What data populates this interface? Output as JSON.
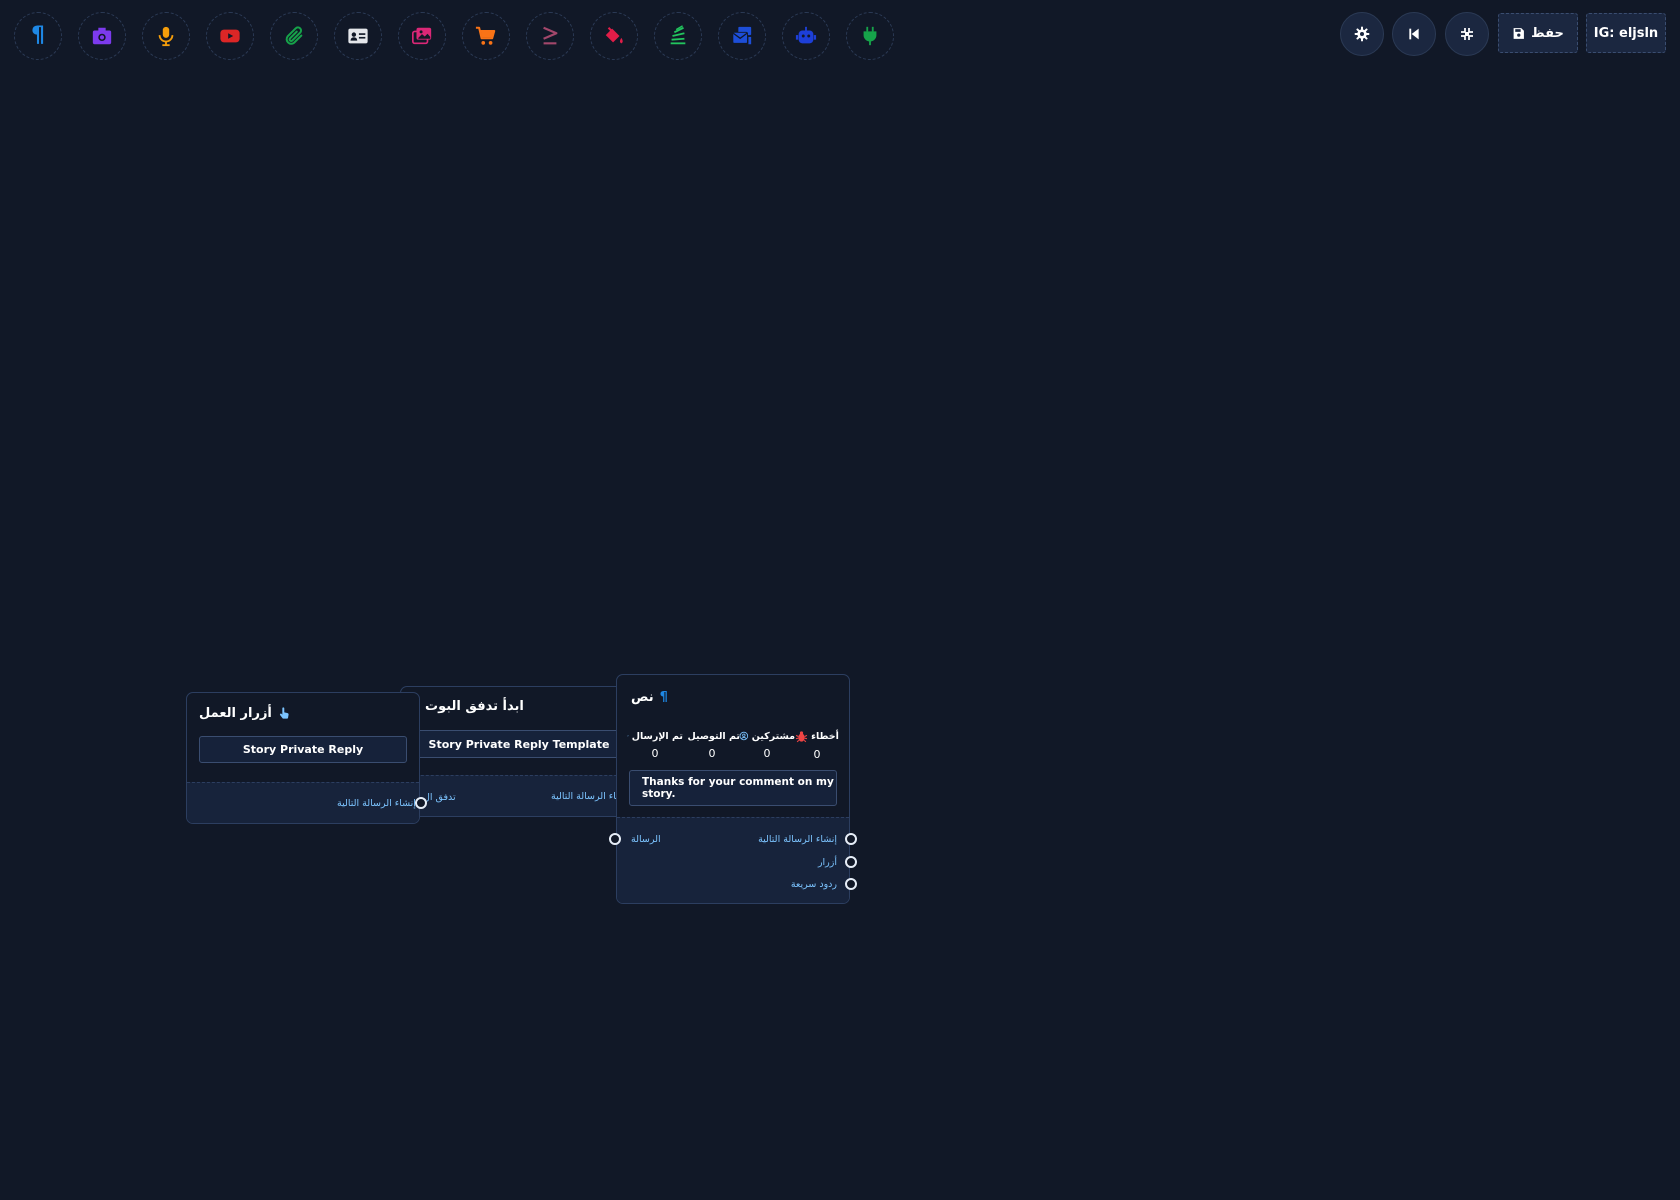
{
  "toolbar": {
    "icons": [
      {
        "name": "paragraph-icon",
        "color": "#1e88e5"
      },
      {
        "name": "camera-icon",
        "color": "#7c3aed"
      },
      {
        "name": "microphone-icon",
        "color": "#f59e0b"
      },
      {
        "name": "youtube-icon",
        "color": "#dc2626"
      },
      {
        "name": "paperclip-icon",
        "color": "#16a34a"
      },
      {
        "name": "contact-card-icon",
        "color": "#e5e7eb"
      },
      {
        "name": "images-icon",
        "color": "#db2777"
      },
      {
        "name": "cart-icon",
        "color": "#f97316"
      },
      {
        "name": "greater-equal-icon",
        "color": "#a3476b"
      },
      {
        "name": "fill-drip-icon",
        "color": "#e11d48"
      },
      {
        "name": "stack-exchange-icon",
        "color": "#22c55e"
      },
      {
        "name": "mail-bulk-icon",
        "color": "#1d4ed8"
      },
      {
        "name": "robot-icon",
        "color": "#1d3fd8"
      },
      {
        "name": "plug-icon",
        "color": "#16a34a"
      }
    ],
    "save_label": "حفظ",
    "account_label": "IG: eljsln"
  },
  "nodes": {
    "action_buttons": {
      "title": "أزرار العمل",
      "field": "Story Private Reply",
      "port_next": "إنشاء الرسالة التالية"
    },
    "start_flow": {
      "title": "ابدأ تدفق البوت",
      "field": "Story Private Reply Template",
      "port_left": "تدفق ال",
      "port_next": "إنشاء الرسالة التالية"
    },
    "text": {
      "title": "نص",
      "stats": [
        {
          "label": "أخطاء",
          "value": "0",
          "icon": "bug-icon",
          "color": "#ef4444"
        },
        {
          "label": "مشتركين",
          "value": "0",
          "icon": "user-circle-icon",
          "color": "#7cc4ff"
        },
        {
          "label": "تم التوصيل",
          "value": "0",
          "icon": "check-circle-icon",
          "color": "#4ade80"
        },
        {
          "label": "تم الإرسال",
          "value": "0",
          "icon": "paper-plane-icon",
          "color": "#7cc4ff"
        }
      ],
      "message": "Thanks for your comment on my story.",
      "port_in": "الرسالة",
      "port_next": "إنشاء الرسالة التالية",
      "port_buttons": "أزرار",
      "port_quick_replies": "ردود سريعة"
    }
  }
}
